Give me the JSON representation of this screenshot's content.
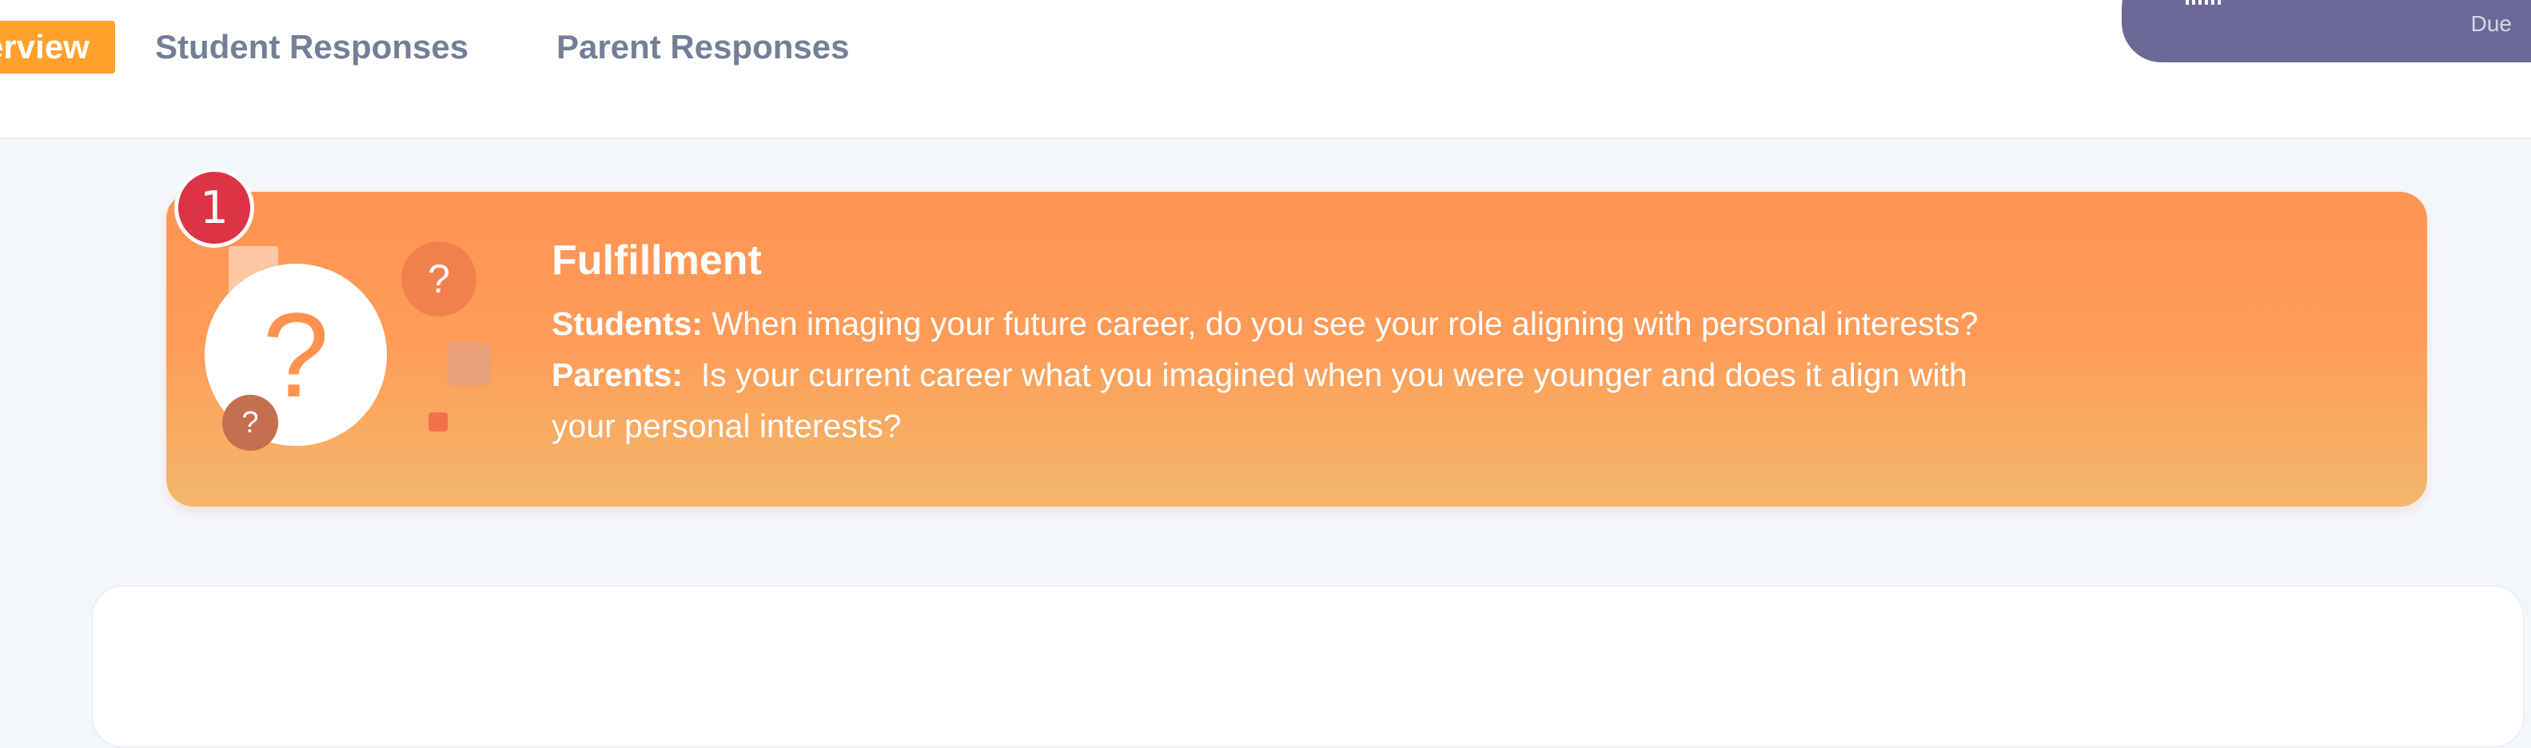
{
  "tabs": {
    "overview": "Overview",
    "student_responses": "Student Responses",
    "parent_responses": "Parent Responses"
  },
  "due_card": {
    "label": "Due"
  },
  "question": {
    "number": "1",
    "title": "Fulfillment",
    "students_label": "Students:",
    "students_text": "When imaging your future career, do you see your role aligning with personal interests?",
    "parents_label": "Parents:",
    "parents_text_line1": "Is your current career what you imagined when you were younger and does it align with",
    "parents_text_line2": "your personal interests?",
    "icon": "question-mark-icon"
  },
  "colors": {
    "overview_tab": "#ffa12b",
    "banner_top": "#ff9455",
    "banner_bottom": "#f3b76c",
    "badge": "#dd3445",
    "due_card": "#6d6996",
    "tab_text": "#737f96"
  }
}
